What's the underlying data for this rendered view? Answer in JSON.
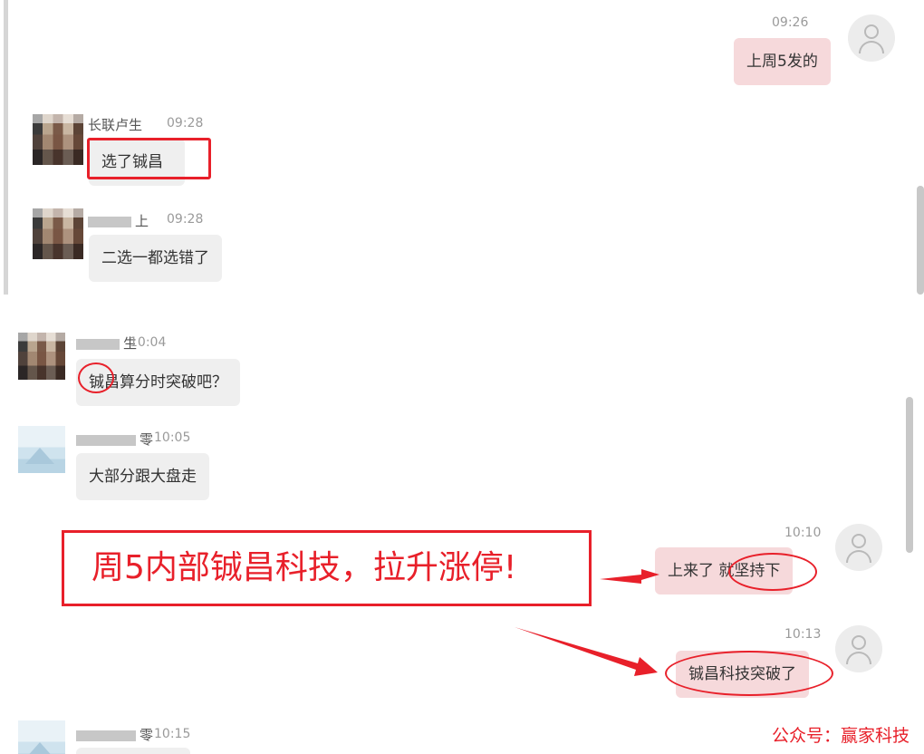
{
  "top_panel": {
    "msg1": {
      "time": "09:26",
      "text": "上周5发的"
    },
    "msg2": {
      "name": "长联卢生",
      "time": "09:28",
      "text": "选了铖昌"
    },
    "msg3": {
      "name_visible": "上",
      "time": "09:28",
      "text": "二选一都选错了"
    }
  },
  "bottom_panel": {
    "msg4": {
      "name_visible": "生",
      "time": "10:04",
      "text": "铖昌算分时突破吧？"
    },
    "msg5": {
      "name_visible": "零",
      "time": "10:05",
      "text": "大部分跟大盘走"
    },
    "msg6": {
      "time": "10:10",
      "text": "上来了 就坚持下"
    },
    "msg7": {
      "time": "10:13",
      "text": "铖昌科技突破了"
    },
    "msg8": {
      "name_visible": "零",
      "time": "10:15"
    }
  },
  "annotation": {
    "callout": "周5内部铖昌科技，拉升涨停!"
  },
  "watermark": "公众号：赢家科技",
  "colors": {
    "accent_red": "#e8202a",
    "out_bubble": "#f6d9db",
    "in_bubble": "#efefef"
  },
  "icons": [
    "user-avatar-icon",
    "mosaic-avatar",
    "image-avatar"
  ]
}
